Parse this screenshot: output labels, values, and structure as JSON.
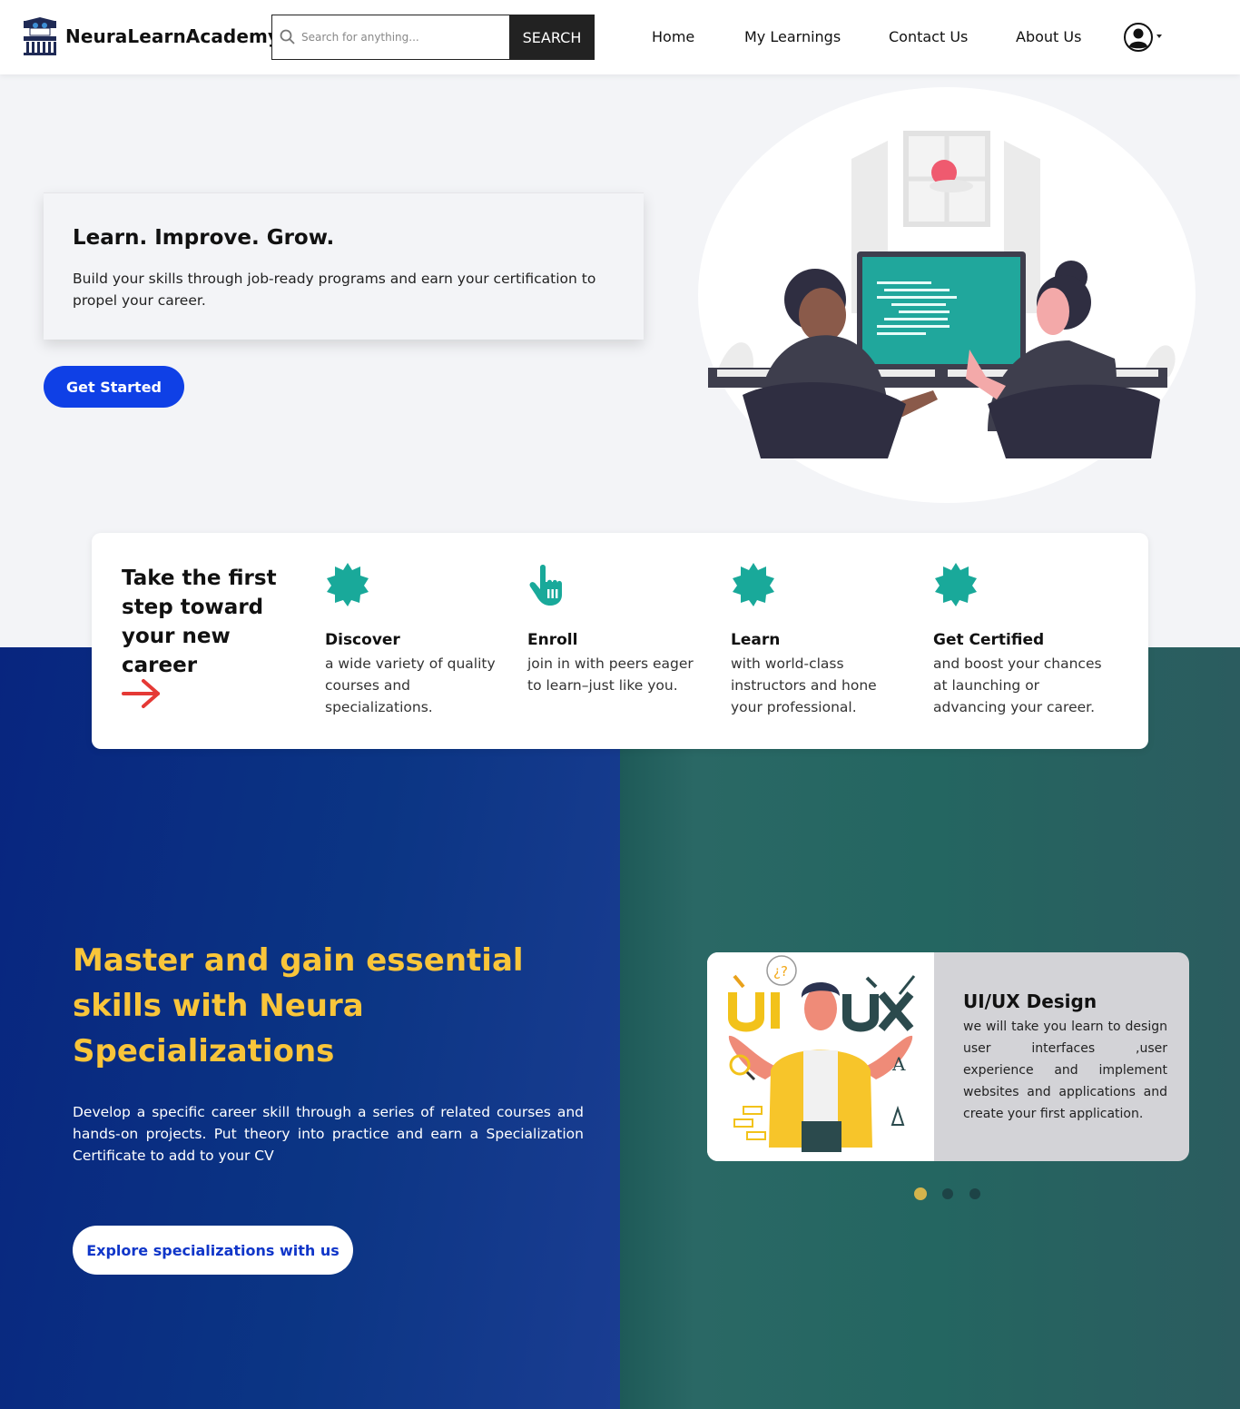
{
  "nav": {
    "brand": "NeuraLearnAcademy",
    "search_placeholder": "Search for anything...",
    "search_button": "SEARCH",
    "links": [
      "Home",
      "My Learnings",
      "Contact Us",
      "About Us"
    ]
  },
  "hero": {
    "title": "Learn. Improve. Grow.",
    "subtitle": "Build your skills through job-ready programs and earn your certification to propel your career.",
    "cta": "Get Started"
  },
  "steps": {
    "title": "Take the first step toward your new career",
    "items": [
      {
        "title": "Discover",
        "desc": "a wide variety of quality courses and specializations.",
        "icon": "badge-icon"
      },
      {
        "title": "Enroll",
        "desc": "join in with peers eager to learn–just like you.",
        "icon": "pointer-hand-icon"
      },
      {
        "title": "Learn",
        "desc": "with world-class instructors and hone your professional.",
        "icon": "badge-icon"
      },
      {
        "title": "Get Certified",
        "desc": "and boost your chances at launching or advancing your career.",
        "icon": "badge-icon"
      }
    ]
  },
  "specializations": {
    "title": "Master and gain essential skills with Neura Specializations",
    "description": "Develop a specific career skill through a series of related courses and hands-on projects. Put theory into practice and earn a Specialization Certificate to add to your CV",
    "cta": "Explore specializations with us"
  },
  "carousel": {
    "active_index": 0,
    "slide_count": 3,
    "slide": {
      "title": "UI/UX Design",
      "description": "we will take you learn to design user interfaces ,user experience and implement websites and applications and create your first application."
    }
  },
  "colors": {
    "accent_blue": "#0f40e6",
    "teal_icon": "#19a99a",
    "heading_yellow": "#f9c53a",
    "arrow_red": "#e53935",
    "dot_active": "#d4b44c",
    "dot_inactive": "#1d4346"
  }
}
